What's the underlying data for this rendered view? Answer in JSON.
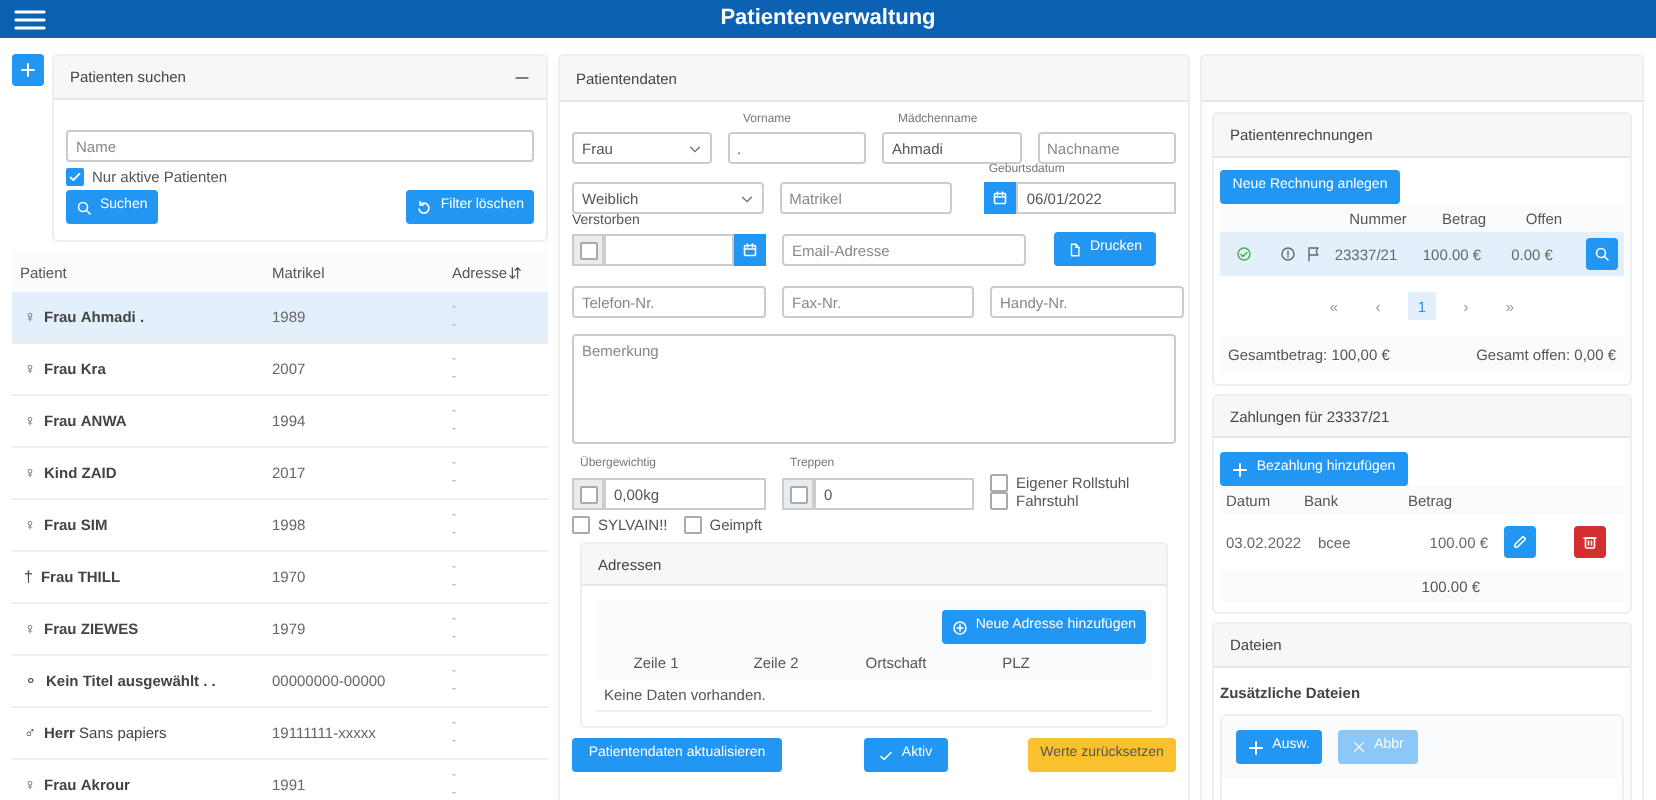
{
  "header": {
    "title": "Patientenverwaltung"
  },
  "search": {
    "title": "Patienten suchen",
    "name_placeholder": "Name",
    "active_only": {
      "label": "Nur aktive Patienten",
      "checked": true
    },
    "search_button": "Suchen",
    "clear_button": "Filter löschen"
  },
  "patients": {
    "columns": [
      "Patient",
      "Matrikel",
      "Adresse"
    ],
    "rows": [
      {
        "symbol": "♀",
        "title": "Frau",
        "name": "Ahmadi .",
        "name_bold": true,
        "matrikel": "1989",
        "address": [
          "-",
          "-"
        ],
        "selected": true
      },
      {
        "symbol": "♀",
        "title": "Frau",
        "name": "Kra",
        "name_bold": true,
        "matrikel": "2007",
        "address": [
          "-",
          "-"
        ],
        "selected": false
      },
      {
        "symbol": "♀",
        "title": "Frau",
        "name": "ANWA",
        "name_bold": true,
        "matrikel": "1994",
        "address": [
          "-",
          "-"
        ],
        "selected": false
      },
      {
        "symbol": "♀",
        "title": "Kind",
        "name": "ZAID",
        "name_bold": true,
        "matrikel": "2017",
        "address": [
          "-",
          "-"
        ],
        "selected": false
      },
      {
        "symbol": "♀",
        "title": "Frau",
        "name": "SIM",
        "name_bold": true,
        "matrikel": "1998",
        "address": [
          "-",
          "-"
        ],
        "selected": false
      },
      {
        "symbol": "†",
        "title": "Frau",
        "name": "THILL",
        "name_bold": true,
        "matrikel": "1970",
        "address": [
          "-",
          "-"
        ],
        "selected": false
      },
      {
        "symbol": "♀",
        "title": "Frau",
        "name": "ZIEWES",
        "name_bold": true,
        "matrikel": "1979",
        "address": [
          "-",
          "-"
        ],
        "selected": false
      },
      {
        "symbol": "⚬",
        "title": "Kein Titel ausgewählt",
        "name": ". .",
        "name_bold": true,
        "matrikel": "00000000-00000",
        "address": [
          "-",
          "-"
        ],
        "selected": false
      },
      {
        "symbol": "♂",
        "title": "Herr",
        "name": "Sans papiers",
        "name_bold": false,
        "matrikel": "19111111-xxxxx",
        "address": [
          "-",
          "-"
        ],
        "selected": false
      },
      {
        "symbol": "♀",
        "title": "Frau",
        "name": "Akrour",
        "name_bold": true,
        "matrikel": "1991",
        "address": [
          "-",
          "-"
        ],
        "selected": false
      }
    ]
  },
  "patient_data": {
    "title": "Patientendaten",
    "salutation": "Frau",
    "first_name": {
      "label": "Vorname",
      "value": "."
    },
    "maiden_name": {
      "label": "Mädchenname",
      "value": "Ahmadi"
    },
    "last_name": {
      "placeholder": "Nachname"
    },
    "sex": "Weiblich",
    "matrikel": {
      "placeholder": "Matrikel"
    },
    "birth_date": {
      "label": "Geburtsdatum",
      "value": "06/01/2022"
    },
    "deceased": {
      "label": "Verstorben",
      "checked": false
    },
    "email": {
      "placeholder": "Email-Adresse"
    },
    "print_button": "Drucken",
    "phone": {
      "placeholder": "Telefon-Nr."
    },
    "fax": {
      "placeholder": "Fax-Nr."
    },
    "mobile": {
      "placeholder": "Handy-Nr."
    },
    "remark": {
      "placeholder": "Bemerkung"
    },
    "overweight": {
      "label": "Übergewichtig",
      "checked": false,
      "value": "0,00kg"
    },
    "stairs": {
      "label": "Treppen",
      "checked": false,
      "value": "0"
    },
    "flags": [
      {
        "label": "Eigener Rollstuhl",
        "checked": false
      },
      {
        "label": "Fahrstuhl",
        "checked": false
      },
      {
        "label": "SYLVAIN!!",
        "checked": false
      },
      {
        "label": "Geimpft",
        "checked": false
      }
    ],
    "addresses": {
      "title": "Adressen",
      "add_button": "Neue Adresse hinzufügen",
      "columns": [
        "Zeile 1",
        "Zeile 2",
        "Ortschaft",
        "PLZ"
      ],
      "empty": "Keine Daten vorhanden."
    },
    "buttons": {
      "update": "Patientendaten aktualisieren",
      "active": "Aktiv",
      "reset": "Werte zurücksetzen"
    }
  },
  "invoices": {
    "title": "Patientenrechnungen",
    "new_button": "Neue Rechnung anlegen",
    "columns": [
      "Nummer",
      "Betrag",
      "Offen"
    ],
    "rows": [
      {
        "paid": true,
        "number": "23337/21",
        "amount": "100.00 €",
        "open": "0.00 €",
        "selected": true
      }
    ],
    "pager": {
      "first": "«",
      "prev": "‹",
      "pages": [
        {
          "label": "1",
          "selected": true
        }
      ],
      "next": "›",
      "last": "»"
    },
    "total": "Gesamtbetrag: 100,00 €",
    "total_open": "Gesamt offen: 0,00 €"
  },
  "payments": {
    "title": "Zahlungen für 23337/21",
    "add_button": "Bezahlung hinzufügen",
    "columns": [
      "Datum",
      "Bank",
      "Betrag"
    ],
    "rows": [
      {
        "date": "03.02.2022",
        "bank": "bcee",
        "amount": "100.00 €"
      }
    ],
    "total": "100.00 €"
  },
  "files": {
    "title": "Dateien",
    "subtitle": "Zusätzliche Dateien",
    "choose_button": "Ausw.",
    "cancel_button": {
      "label": "Abbr",
      "disabled": true
    }
  }
}
